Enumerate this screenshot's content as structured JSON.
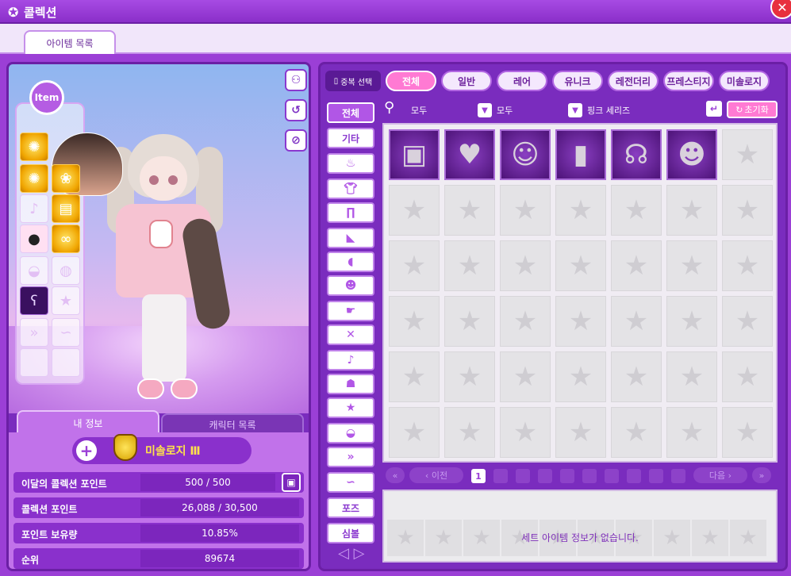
{
  "window": {
    "title": "콜렉션",
    "close_label": "✕"
  },
  "tabs": {
    "items": "아이템 목록"
  },
  "left": {
    "item_badge": "Item",
    "info_tabs": {
      "my_info": "내 정보",
      "char_list": "캐릭터 목록"
    },
    "grade_name": "미솔로지 Ⅲ",
    "stats": [
      {
        "label": "이달의 콜렉션 포인트",
        "value": "500 / 500"
      },
      {
        "label": "콜렉션 포인트",
        "value": "26,088 / 30,500"
      },
      {
        "label": "포인트 보유량",
        "value": "10.85%"
      },
      {
        "label": "순위",
        "value": "89674"
      }
    ]
  },
  "right": {
    "multi_select": "중복 선택",
    "rarity_tabs": [
      "전체",
      "일반",
      "레어",
      "유니크",
      "레전더리",
      "프레스티지",
      "미솔로지"
    ],
    "categories": {
      "all": "전체",
      "etc": "기타",
      "pose": "포즈",
      "symbol": "심볼"
    },
    "filters": {
      "f1": "모두",
      "f2": "모두",
      "f3": "핑크 세리즈"
    },
    "reset": "초기화",
    "pager": {
      "prev": "이전",
      "next": "다음",
      "page": "1"
    },
    "set_message": "세트 아이템 정보가 없습니다."
  },
  "colors": {
    "accent": "#9b3fd6",
    "active_tab": "#ff7ad3",
    "grade_text": "#ffe24a"
  }
}
